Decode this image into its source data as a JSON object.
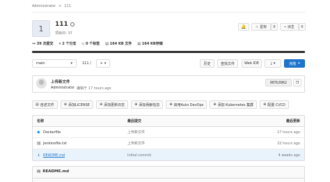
{
  "breadcrumb": {
    "parent": "Administrator",
    "sep": ">",
    "current": "111"
  },
  "project": {
    "avatar_letter": "1",
    "name": "111",
    "visibility_icon": "globe-icon",
    "id_text": "项目ID: 37"
  },
  "actions": {
    "notify_icon": "bell-icon",
    "star_icon": "star-icon",
    "star_label": "星标",
    "star_count": "0",
    "fork_icon": "fork-icon",
    "fork_label": "派生",
    "fork_count": "0"
  },
  "stats": {
    "commits": "39 次提交",
    "branches": "2 个分支",
    "tags": "0 个标签",
    "files": "164 KB 文件",
    "storage": "164 KB存储"
  },
  "toolbar": {
    "branch": "main",
    "path": "111 /",
    "add": "+",
    "history": "历史",
    "find_file": "查找文件",
    "web_ide": "Web IDE",
    "download_icon": "download-icon",
    "clone": "克隆"
  },
  "last_commit": {
    "title": "上传新文件",
    "author": "Administrator",
    "time": "编辑于 17 hours ago",
    "sha": "007b3962",
    "copy_icon": "copy-icon"
  },
  "quick_actions": [
    "自述文件",
    "添加LICENSE",
    "添加更新日志",
    "添加贡献信息",
    "启用Auto DevOps",
    "添加 Kubernetes 集群",
    "配置 CI/CD"
  ],
  "table": {
    "headers": {
      "name": "名称",
      "commit": "最后提交",
      "updated": "最后更新"
    },
    "rows": [
      {
        "icon": "docker-icon",
        "name": "Dockerfile",
        "commit": "上传新文件",
        "updated": "17 hours ago"
      },
      {
        "icon": "file-icon",
        "name": "Jenkinsfile.txt",
        "commit": "上传新文件",
        "updated": "22 hours ago"
      },
      {
        "icon": "markdown-icon",
        "name": "README.md",
        "commit": "Initial commit",
        "updated": "4 weeks ago"
      }
    ]
  },
  "readme": {
    "icon": "file-icon",
    "title": "README.md"
  },
  "colors": {
    "primary": "#1f75cb",
    "bar": "#2e2e2e",
    "highlight_row": "#e9f3fc",
    "link": "#1f75cb"
  }
}
